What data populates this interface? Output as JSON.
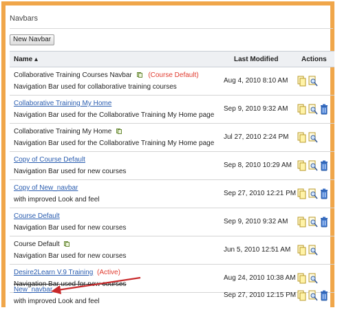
{
  "section_title": "Navbars",
  "new_button": "New Navbar",
  "columns": {
    "name": "Name ▴",
    "modified": "Last Modified",
    "actions": "Actions"
  },
  "colors": {
    "frame": "#f0a64a",
    "link": "#2a5db0",
    "alert": "#e03a2e"
  },
  "rows": [
    {
      "name": "Collaborative Training Courses Navbar",
      "note": "(Course Default)",
      "desc": "Navigation Bar used for collaborative training courses",
      "date": "Aug 4, 2010 8:10 AM"
    },
    {
      "name": "Collaborative Training My Home",
      "desc": "Navigation Bar used for the Collaborative Training My Home page",
      "date": "Sep 9, 2010 9:32 AM"
    },
    {
      "name": "Collaborative Training My Home",
      "desc": "Navigation Bar used for the Collaborative Training My Home page",
      "date": "Jul 27, 2010 2:24 PM"
    },
    {
      "name": "Copy of Course Default",
      "desc": "Navigation Bar used for new courses",
      "date": "Sep 8, 2010 10:29 AM"
    },
    {
      "name": "Copy of New_navbar",
      "desc": "with improved Look and feel",
      "date": "Sep 27, 2010 12:21 PM"
    },
    {
      "name": "Course Default",
      "desc": "Navigation Bar used for new courses",
      "date": "Sep 9, 2010 9:32 AM"
    },
    {
      "name": "Course Default",
      "desc": "Navigation Bar used for new courses",
      "date": "Jun 5, 2010 12:51 AM"
    },
    {
      "name": "Desire2Learn V.9 Training",
      "note": "(Active)",
      "desc": "Navigation Bar used for new courses",
      "date": "Aug 24, 2010 10:38 AM"
    },
    {
      "name": "New_navbar",
      "desc": "with improved Look and feel",
      "date": "Sep 27, 2010 12:15 PM"
    }
  ]
}
